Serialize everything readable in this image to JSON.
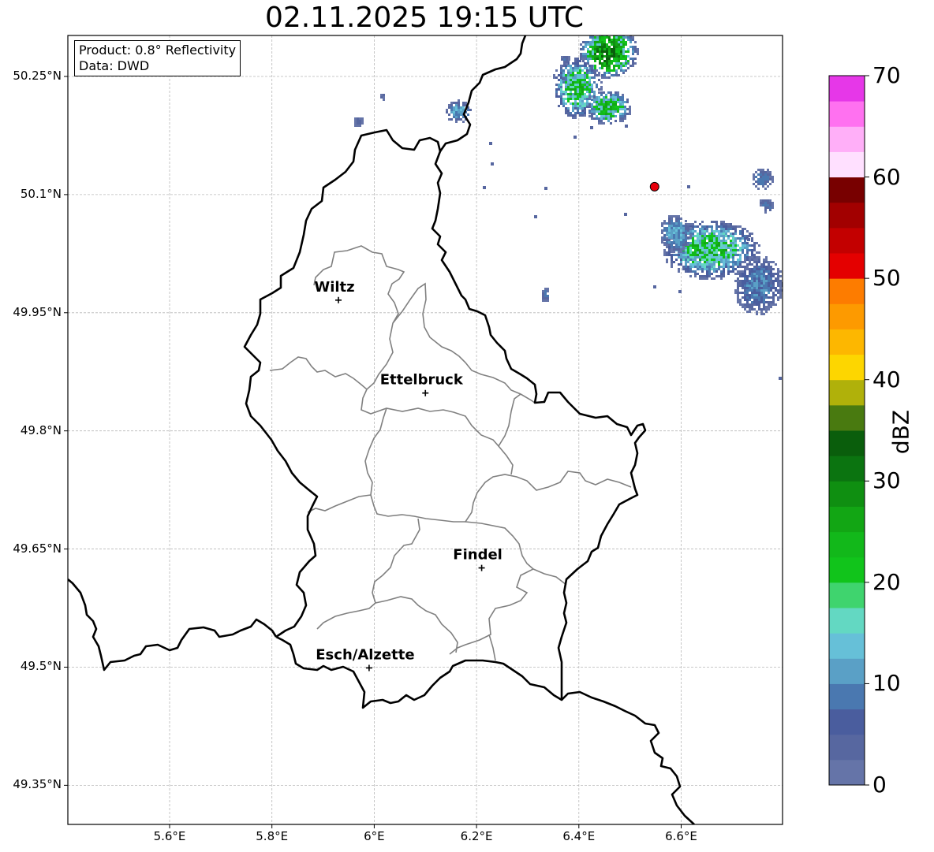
{
  "title": "02.11.2025 19:15 UTC",
  "info": {
    "product": "Product: 0.8° Reflectivity",
    "source": "Data: DWD"
  },
  "lat_ticks": [
    "50.25°N",
    "50.1°N",
    "49.95°N",
    "49.8°N",
    "49.65°N",
    "49.5°N",
    "49.35°N"
  ],
  "lon_ticks": [
    "5.6°E",
    "5.8°E",
    "6°E",
    "6.2°E",
    "6.4°E",
    "6.6°E"
  ],
  "cities": [
    {
      "name": "Wiltz",
      "lon": 5.93,
      "lat": 49.966
    },
    {
      "name": "Ettelbruck",
      "lon": 6.1,
      "lat": 49.848
    },
    {
      "name": "Findel",
      "lon": 6.21,
      "lat": 49.626
    },
    {
      "name": "Esch/Alzette",
      "lon": 5.99,
      "lat": 49.499
    }
  ],
  "radar_site": {
    "lon": 6.548,
    "lat": 50.11,
    "color": "#e8000b"
  },
  "colorbar": {
    "label": "dBZ",
    "ticks": [
      "0",
      "10",
      "20",
      "30",
      "40",
      "50",
      "60",
      "70"
    ],
    "min": 0,
    "max": 70,
    "step": 2.5,
    "colors": [
      "#6574a8",
      "#5767a0",
      "#4a5d9e",
      "#4a78b0",
      "#5aa0c6",
      "#66c0d8",
      "#63d8c2",
      "#3fd46e",
      "#11c41b",
      "#12b81a",
      "#12a614",
      "#0f8f11",
      "#0b7410",
      "#0a5e0c",
      "#497a10",
      "#b0b10a",
      "#fdd600",
      "#fdb700",
      "#fd9a00",
      "#fd7c00",
      "#e40000",
      "#c30000",
      "#a20000",
      "#780000",
      "#ffe0ff",
      "#ffaff8",
      "#ff71f0",
      "#e637e8"
    ]
  }
}
